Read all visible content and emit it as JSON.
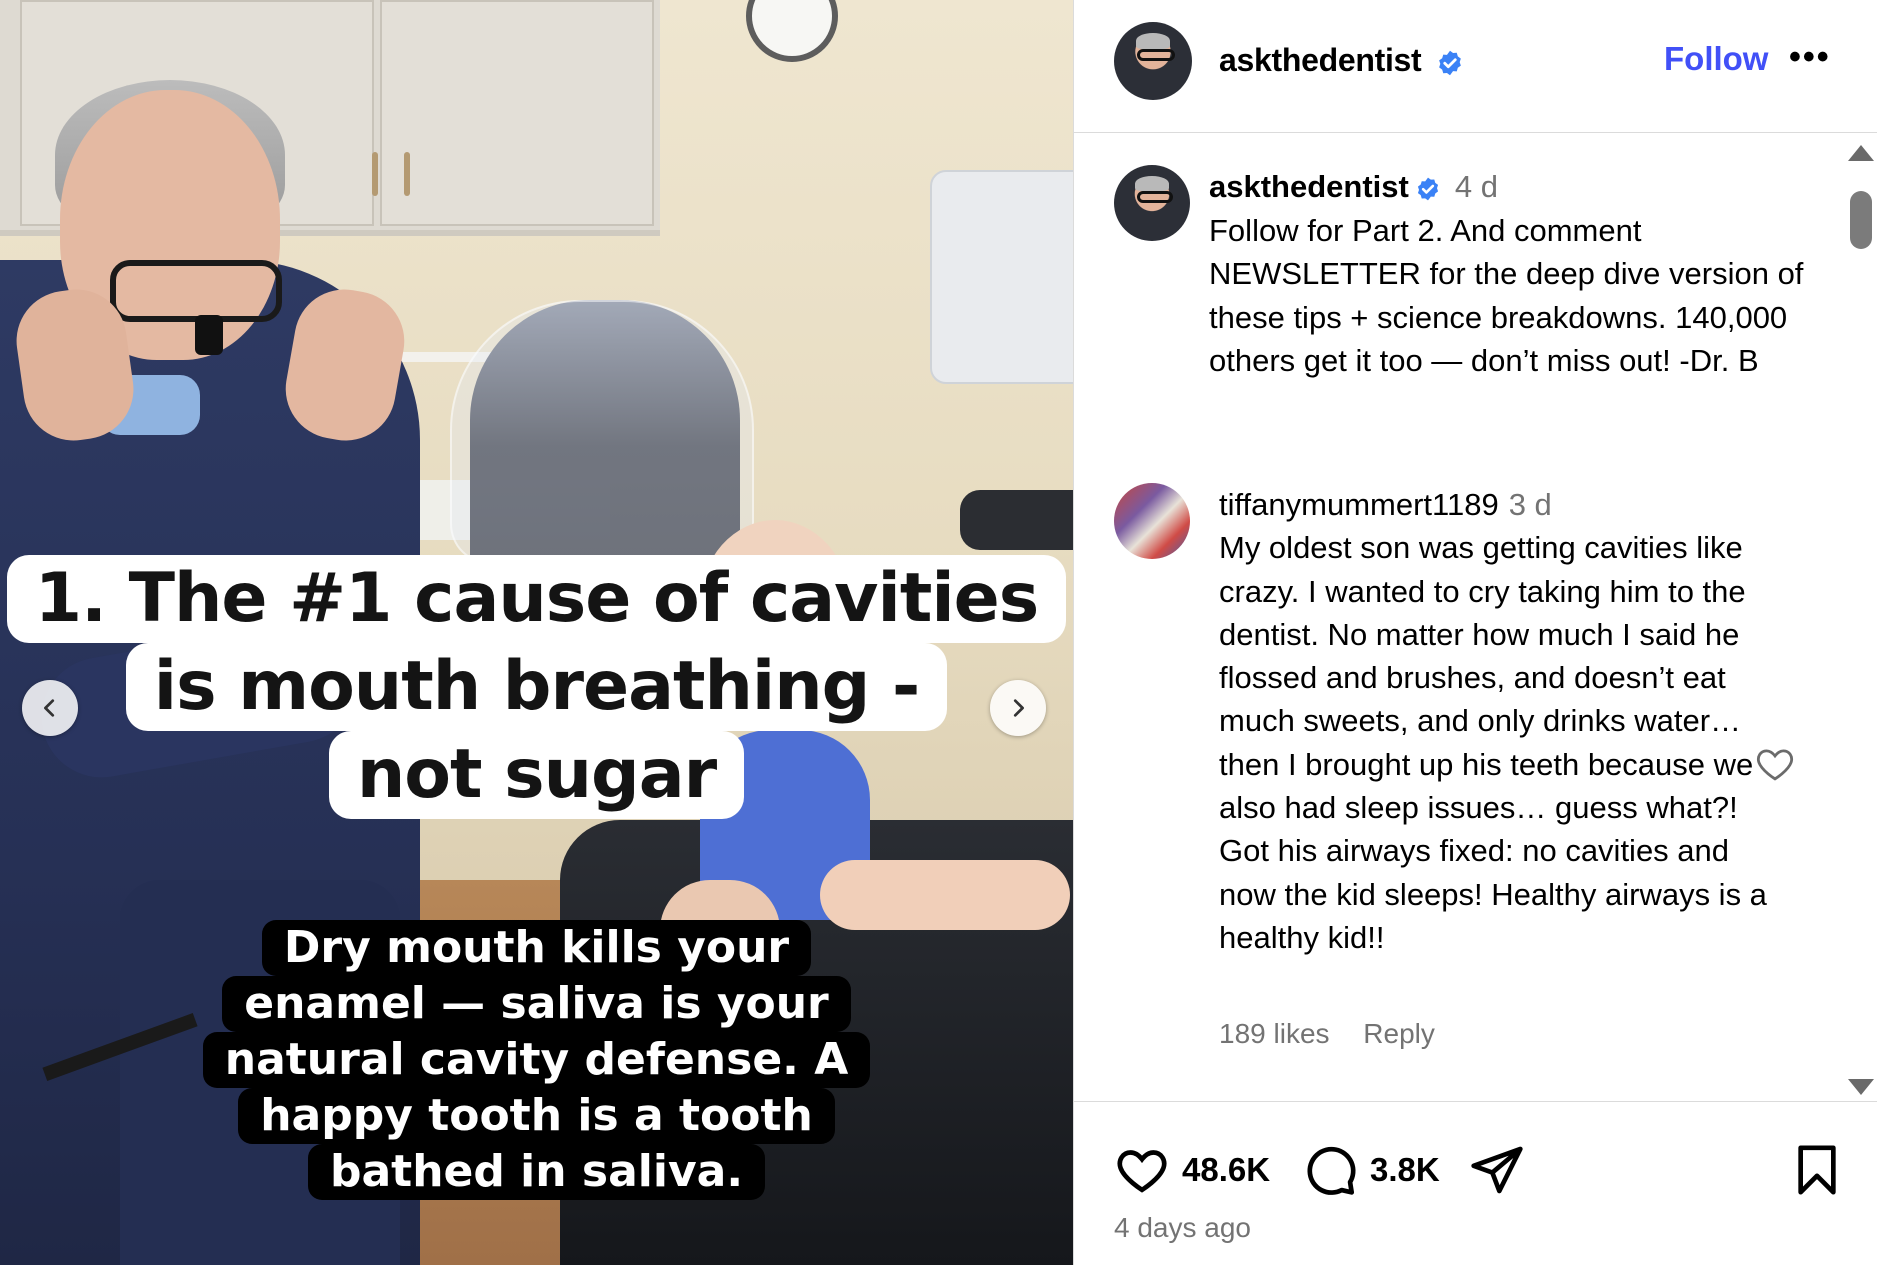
{
  "media": {
    "headline": [
      "1. The #1 cause of cavities",
      "is mouth breathing -",
      "not sugar"
    ],
    "subtext": [
      "Dry mouth kills your",
      "enamel — saliva is your",
      "natural cavity defense. A",
      "happy tooth is a tooth",
      "bathed in saliva."
    ]
  },
  "header": {
    "username": "askthedentist",
    "verified": true,
    "follow_label": "Follow",
    "more_label": "•••"
  },
  "caption": {
    "username": "askthedentist",
    "time": "4 d",
    "text": "Follow for Part 2. And comment NEWSLETTER for the deep dive version of these tips + science breakdowns. 140,000 others get it too — don’t miss out! -Dr. B"
  },
  "comment": {
    "username": "tiffanymummert1189",
    "time": "3 d",
    "text": "My oldest son was getting cavities like crazy. I wanted to cry taking him to the dentist. No matter how much I said he flossed and brushes, and doesn’t eat much sweets, and only drinks water… then I brought up his teeth because we also had sleep issues… guess what?! Got his airways fixed: no cavities and now the kid sleeps! Healthy airways is a healthy kid!!",
    "likes": "189 likes",
    "reply_label": "Reply"
  },
  "actions": {
    "likes_count": "48.6K",
    "comments_count": "3.8K",
    "posted": "4 days ago"
  },
  "icons": {
    "like": "heart-icon",
    "comment": "comment-bubble-icon",
    "share": "paper-plane-icon",
    "save": "bookmark-icon",
    "verified": "verified-badge-icon",
    "prev": "chevron-left-icon",
    "next": "chevron-right-icon"
  },
  "colors": {
    "follow": "#4150f7",
    "verified": "#3b82f6",
    "muted": "#737373"
  }
}
